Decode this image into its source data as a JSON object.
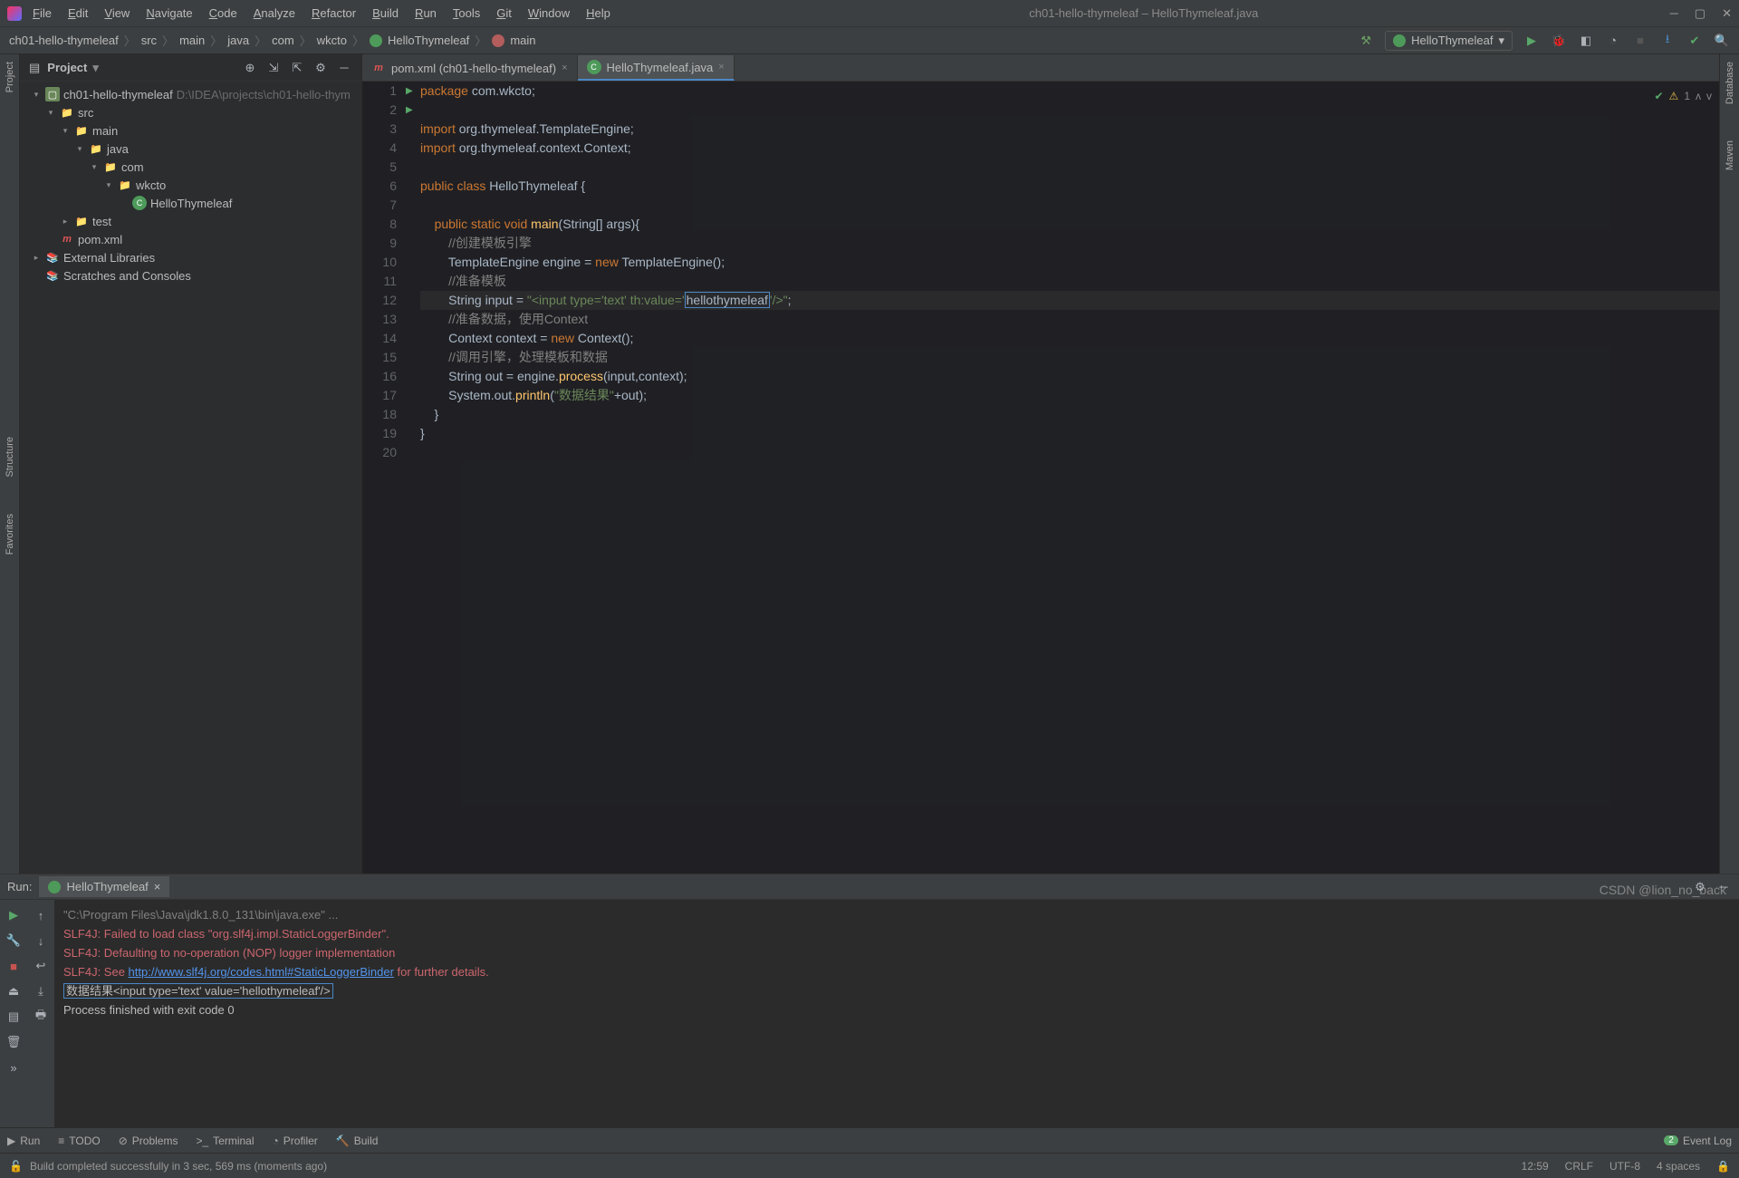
{
  "window": {
    "title": "ch01-hello-thymeleaf – HelloThymeleaf.java"
  },
  "menu": [
    "File",
    "Edit",
    "View",
    "Navigate",
    "Code",
    "Analyze",
    "Refactor",
    "Build",
    "Run",
    "Tools",
    "Git",
    "Window",
    "Help"
  ],
  "breadcrumbs": [
    "ch01-hello-thymeleaf",
    "src",
    "main",
    "java",
    "com",
    "wkcto",
    "HelloThymeleaf",
    "main"
  ],
  "run_config": "HelloThymeleaf",
  "project_panel": {
    "title": "Project",
    "tree": [
      {
        "depth": 0,
        "tw": "▾",
        "icon": "mod",
        "label": "ch01-hello-thymeleaf",
        "suffix": "D:\\IDEA\\projects\\ch01-hello-thym"
      },
      {
        "depth": 1,
        "tw": "▾",
        "icon": "dir",
        "label": "src"
      },
      {
        "depth": 2,
        "tw": "▾",
        "icon": "src",
        "label": "main"
      },
      {
        "depth": 3,
        "tw": "▾",
        "icon": "src",
        "label": "java"
      },
      {
        "depth": 4,
        "tw": "▾",
        "icon": "pkg",
        "label": "com"
      },
      {
        "depth": 5,
        "tw": "▾",
        "icon": "pkg",
        "label": "wkcto"
      },
      {
        "depth": 6,
        "tw": "",
        "icon": "class",
        "label": "HelloThymeleaf"
      },
      {
        "depth": 2,
        "tw": "▸",
        "icon": "dir",
        "label": "test"
      },
      {
        "depth": 1,
        "tw": "",
        "icon": "maven",
        "label": "pom.xml"
      },
      {
        "depth": 0,
        "tw": "▸",
        "icon": "lib",
        "label": "External Libraries"
      },
      {
        "depth": 0,
        "tw": "",
        "icon": "lib",
        "label": "Scratches and Consoles"
      }
    ]
  },
  "tabs": [
    {
      "icon": "maven",
      "label": "pom.xml (ch01-hello-thymeleaf)",
      "active": false
    },
    {
      "icon": "class",
      "label": "HelloThymeleaf.java",
      "active": true
    }
  ],
  "inspection": {
    "warnings": "1"
  },
  "code_lines": [
    {
      "n": 1,
      "html": "<span class='kw'>package</span> com.wkcto;"
    },
    {
      "n": 2,
      "html": ""
    },
    {
      "n": 3,
      "html": "<span class='kw'>import</span> org.thymeleaf.TemplateEngine;"
    },
    {
      "n": 4,
      "html": "<span class='kw'>import</span> org.thymeleaf.context.Context;"
    },
    {
      "n": 5,
      "html": ""
    },
    {
      "n": 6,
      "html": "<span class='kw'>public class</span> <span class='cls'>HelloThymeleaf</span> {",
      "mark": "▶"
    },
    {
      "n": 7,
      "html": ""
    },
    {
      "n": 8,
      "html": "    <span class='kw'>public static void</span> <span class='fn'>main</span>(String[] args){",
      "mark": "▶"
    },
    {
      "n": 9,
      "html": "        <span class='cmt'>//创建模板引擎</span>"
    },
    {
      "n": 10,
      "html": "        TemplateEngine engine = <span class='kw'>new</span> TemplateEngine();"
    },
    {
      "n": 11,
      "html": "        <span class='cmt'>//准备模板</span>"
    },
    {
      "n": 12,
      "html": "        String input = <span class='str'>\"&lt;input type='text' th:value='</span><span class='highlight-box'>hellothymeleaf</span><span class='str'>'/&gt;\"</span>;",
      "current": true
    },
    {
      "n": 13,
      "html": "        <span class='cmt'>//准备数据，使用Context</span>"
    },
    {
      "n": 14,
      "html": "        Context context = <span class='kw'>new</span> Context();"
    },
    {
      "n": 15,
      "html": "        <span class='cmt'>//调用引擎，处理模板和数据</span>"
    },
    {
      "n": 16,
      "html": "        String out = engine.<span class='fn'>process</span>(input,context);"
    },
    {
      "n": 17,
      "html": "        System.out.<span class='fn'>println</span>(<span class='str'>\"数据结果\"</span>+out);"
    },
    {
      "n": 18,
      "html": "    }"
    },
    {
      "n": 19,
      "html": "}"
    },
    {
      "n": 20,
      "html": ""
    }
  ],
  "run": {
    "title": "Run:",
    "tab": "HelloThymeleaf",
    "lines": [
      {
        "cls": "c-gray",
        "text": "\"C:\\Program Files\\Java\\jdk1.8.0_131\\bin\\java.exe\" ..."
      },
      {
        "cls": "c-err",
        "text": "SLF4J: Failed to load class \"org.slf4j.impl.StaticLoggerBinder\"."
      },
      {
        "cls": "c-err",
        "text": "SLF4J: Defaulting to no-operation (NOP) logger implementation"
      },
      {
        "cls": "c-err",
        "html": "SLF4J: See <span class='c-link'>http://www.slf4j.org/codes.html#StaticLoggerBinder</span> for further details."
      },
      {
        "cls": "",
        "html": "<span class='c-box'>数据结果&lt;input type='text' value='hellothymeleaf'/&gt;</span>"
      },
      {
        "cls": "",
        "text": ""
      },
      {
        "cls": "",
        "text": "Process finished with exit code 0"
      }
    ]
  },
  "bottom_tools": [
    {
      "icon": "▶",
      "label": "Run"
    },
    {
      "icon": "≡",
      "label": "TODO"
    },
    {
      "icon": "⊘",
      "label": "Problems"
    },
    {
      "icon": ">_",
      "label": "Terminal"
    },
    {
      "icon": "◔",
      "label": "Profiler"
    },
    {
      "icon": "🔨",
      "label": "Build"
    }
  ],
  "event_log": {
    "count": "2",
    "label": "Event Log"
  },
  "status": {
    "msg": "Build completed successfully in 3 sec, 569 ms (moments ago)",
    "time": "12:59",
    "sep": "CRLF",
    "enc": "UTF-8",
    "indent": "4 spaces"
  },
  "left_tabs": [
    "Project",
    "Structure",
    "Favorites"
  ],
  "right_tabs": [
    "Database",
    "Maven"
  ],
  "watermark": "CSDN @lion_no_back"
}
